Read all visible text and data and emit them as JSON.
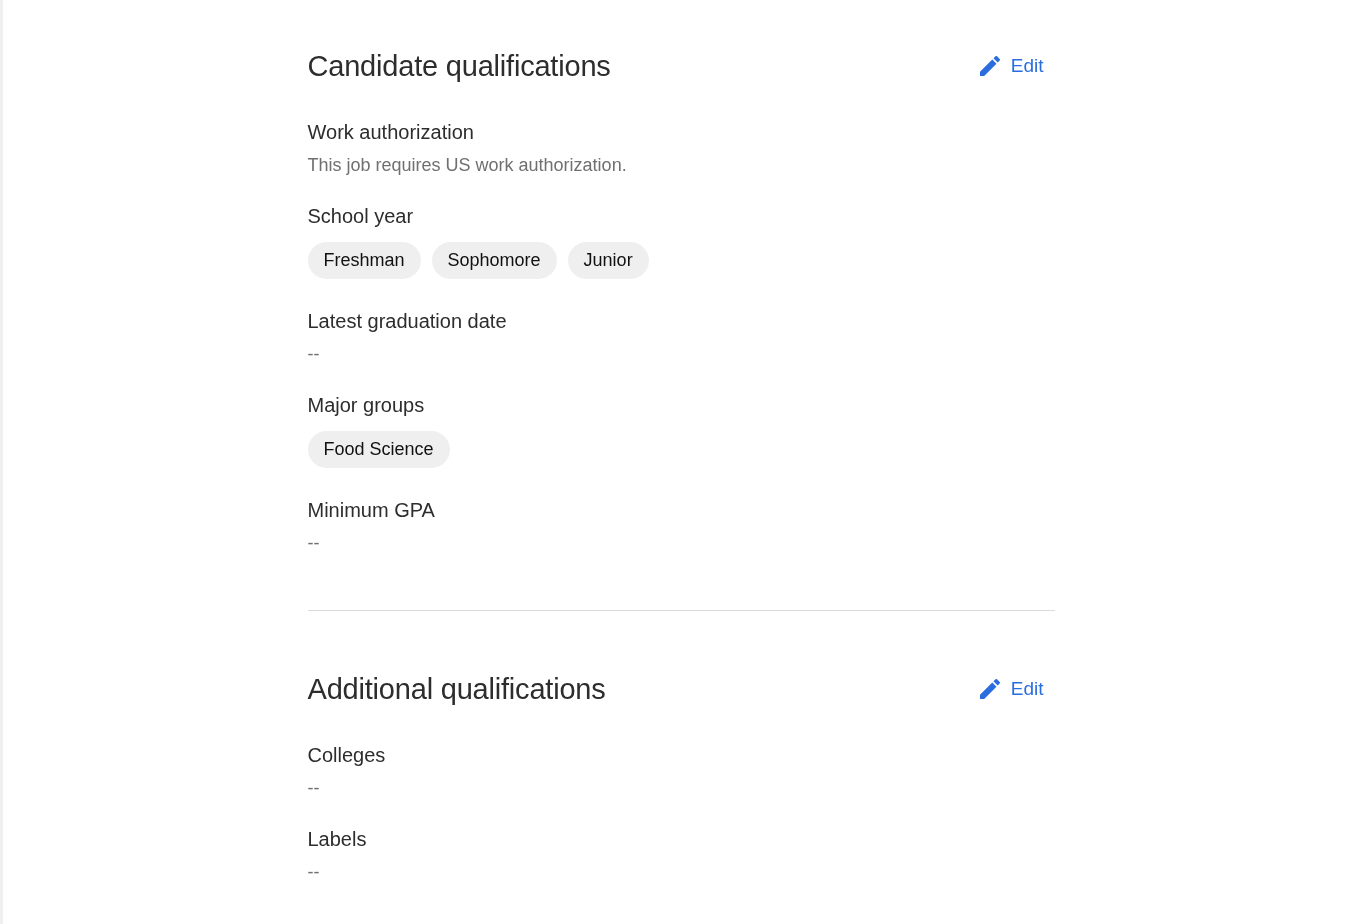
{
  "sections": [
    {
      "title": "Candidate qualifications",
      "edit_label": "Edit",
      "fields": [
        {
          "label": "Work authorization",
          "kind": "text",
          "value": "This job requires US work authorization."
        },
        {
          "label": "School year",
          "kind": "tags",
          "tags": [
            "Freshman",
            "Sophomore",
            "Junior"
          ]
        },
        {
          "label": "Latest graduation date",
          "kind": "text",
          "value": "--"
        },
        {
          "label": "Major groups",
          "kind": "tags",
          "tags": [
            "Food Science"
          ]
        },
        {
          "label": "Minimum GPA",
          "kind": "text",
          "value": "--"
        }
      ]
    },
    {
      "title": "Additional qualifications",
      "edit_label": "Edit",
      "fields": [
        {
          "label": "Colleges",
          "kind": "text",
          "value": "--"
        },
        {
          "label": "Labels",
          "kind": "text",
          "value": "--"
        }
      ]
    }
  ]
}
